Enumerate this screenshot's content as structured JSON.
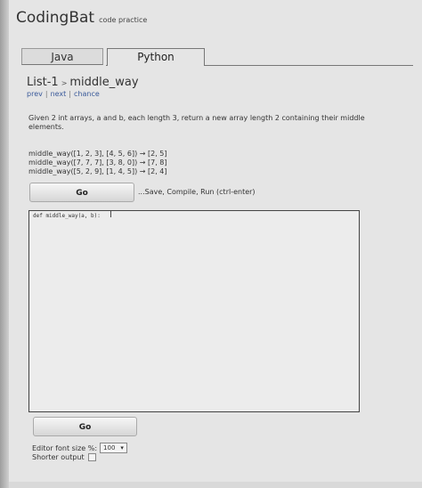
{
  "brand": {
    "name": "CodingBat",
    "subtitle": "code practice"
  },
  "tabs": [
    {
      "label": "Java",
      "active": false
    },
    {
      "label": "Python",
      "active": true
    }
  ],
  "problem": {
    "section": "List-1",
    "separator": ">",
    "name": "middle_way"
  },
  "nav": {
    "prev": "prev",
    "next": "next",
    "chance": "chance",
    "separator": "|"
  },
  "description": "Given 2 int arrays, a and b, each length 3, return a new array length 2 containing their middle elements.",
  "examples": [
    "middle_way([1, 2, 3], [4, 5, 6]) → [2, 5]",
    "middle_way([7, 7, 7], [3, 8, 0]) → [7, 8]",
    "middle_way([5, 2, 9], [1, 4, 5]) → [2, 4]"
  ],
  "go_label": "Go",
  "hint": "...Save, Compile, Run (ctrl-enter)",
  "editor": {
    "code": "def middle_way(a, b):"
  },
  "cursor_glyph": "I",
  "settings": {
    "font_size_label": "Editor font size %:",
    "font_size_value": "100",
    "font_size_arrow": "▾",
    "shorter_output_label": "Shorter output"
  }
}
